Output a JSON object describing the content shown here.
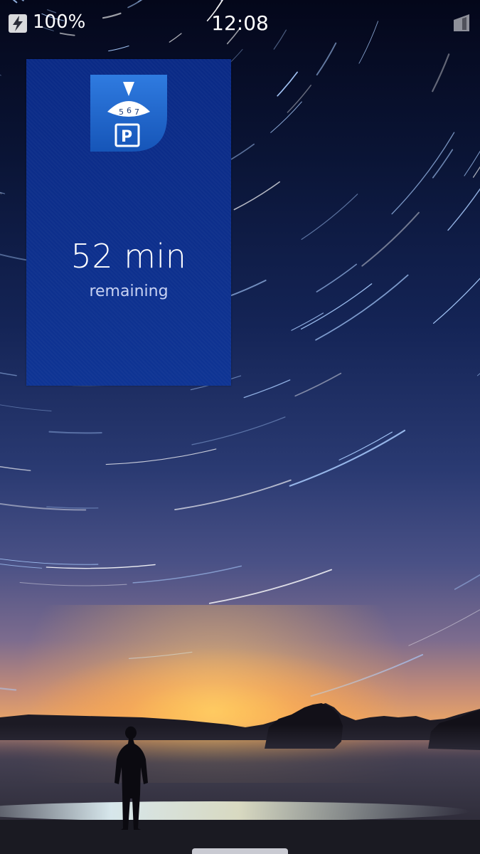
{
  "status_bar": {
    "battery_percent": "100%",
    "time": "12:08",
    "battery_icon": "charging-battery-icon",
    "signal_icon": "cellular-signal-icon"
  },
  "cover": {
    "app_icon": "parking-disc-icon",
    "time_remaining": "52 min",
    "remaining_label": "remaining"
  },
  "wallpaper": {
    "description_colors": {
      "sky_top": "#04071a",
      "horizon_glow": "#ffb43c",
      "cover_blue": "#0a2a86"
    }
  }
}
